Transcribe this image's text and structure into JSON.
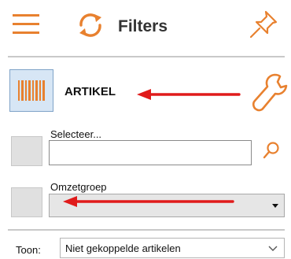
{
  "header": {
    "title": "Filters",
    "icons": [
      "hamburger-menu-icon",
      "refresh-icon",
      "pin-icon"
    ],
    "accent_color": "#e8812f"
  },
  "artikel": {
    "label": "ARTIKEL",
    "icons": [
      "barcode-icon",
      "wrench-icon"
    ]
  },
  "selecteer": {
    "label": "Selecteer...",
    "value": "",
    "icon": "search-icon"
  },
  "omzetgroep": {
    "label": "Omzetgroep",
    "value": ""
  },
  "toon": {
    "label": "Toon:",
    "selected": "Niet gekoppelde artikelen"
  },
  "annotation": {
    "arrow_color": "#e01b1b"
  }
}
